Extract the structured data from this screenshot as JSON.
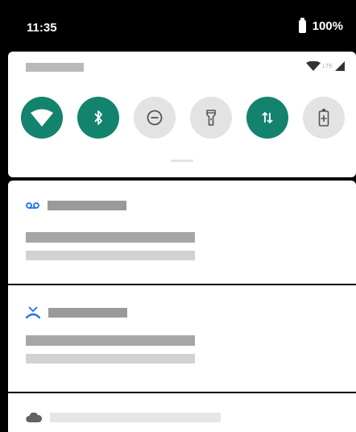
{
  "status_bar": {
    "time": "11:35",
    "battery_percent": "100%",
    "battery_icon": "battery-full-icon"
  },
  "quick_settings": {
    "signal": {
      "wifi_icon": "wifi-icon",
      "network_type": "LTE",
      "cell_icon": "cell-signal-icon"
    },
    "tiles": [
      {
        "name": "wifi",
        "icon": "wifi-icon",
        "state": "on"
      },
      {
        "name": "bluetooth",
        "icon": "bluetooth-icon",
        "state": "on"
      },
      {
        "name": "do-not-disturb",
        "icon": "do-not-disturb-icon",
        "state": "off"
      },
      {
        "name": "flashlight",
        "icon": "flashlight-icon",
        "state": "off"
      },
      {
        "name": "mobile-data",
        "icon": "mobile-data-icon",
        "state": "on"
      },
      {
        "name": "battery-saver",
        "icon": "battery-saver-icon",
        "state": "off"
      }
    ]
  },
  "notifications": [
    {
      "icon": "voicemail-icon",
      "accent": "#1a73e8"
    },
    {
      "icon": "missed-call-icon",
      "accent": "#1a73e8"
    },
    {
      "icon": "cloud-icon",
      "accent": "#5f6368"
    }
  ],
  "colors": {
    "tile_active": "#14836d",
    "tile_inactive": "#e3e3e3",
    "accent": "#1a73e8"
  }
}
